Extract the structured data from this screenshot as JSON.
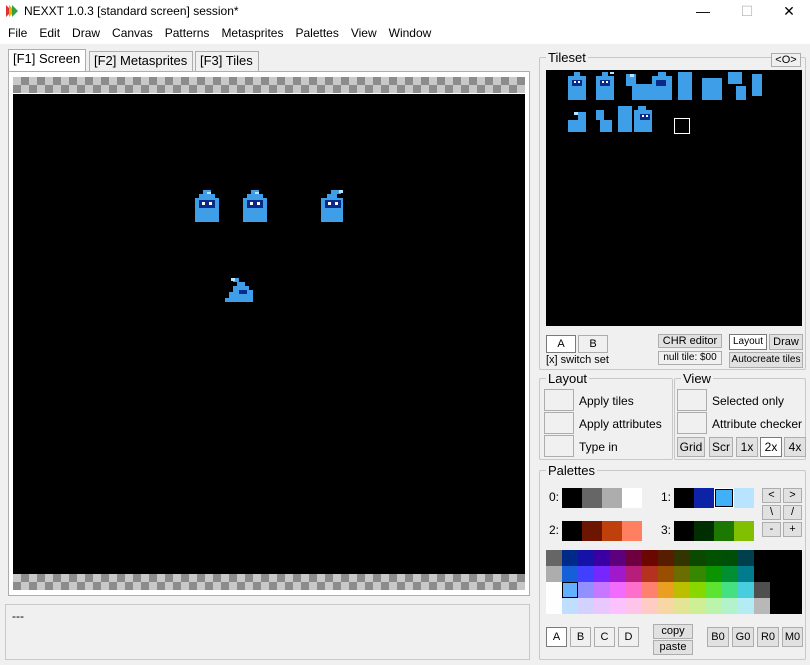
{
  "window": {
    "title": "NEXXT 1.0.3  [standard screen] session*",
    "minimize": "—",
    "maximize": "☐",
    "close": "✕"
  },
  "menu": [
    "File",
    "Edit",
    "Draw",
    "Canvas",
    "Patterns",
    "Metasprites",
    "Palettes",
    "View",
    "Window"
  ],
  "tabs": {
    "screen": "[F1] Screen",
    "metasprites": "[F2] Metasprites",
    "tiles": "[F3] Tiles"
  },
  "status": "---",
  "tileset": {
    "label": "Tileset",
    "toggle": "<O>",
    "set_a": "A",
    "set_b": "B",
    "switch_set": "[x] switch set",
    "chr_editor": "CHR editor",
    "null_tile": "null tile: $00",
    "layout": "Layout",
    "draw": "Draw",
    "autocreate": "Autocreate tiles"
  },
  "layout": {
    "label": "Layout",
    "apply_tiles": "Apply tiles",
    "apply_attributes": "Apply attributes",
    "type_in": "Type in"
  },
  "view": {
    "label": "View",
    "selected_only": "Selected only",
    "attribute_checker": "Attribute checker",
    "grid": "Grid",
    "scr": "Scr",
    "z1": "1x",
    "z2": "2x",
    "z4": "4x"
  },
  "palettes": {
    "label": "Palettes",
    "p0": "0:",
    "p1": "1:",
    "p2": "2:",
    "p3": "3:",
    "pal0": [
      "#000000",
      "#666666",
      "#adadad",
      "#ffffff"
    ],
    "pal1": [
      "#000000",
      "#0c23a8",
      "#40b0f8",
      "#b8e4ff"
    ],
    "pal2": [
      "#000000",
      "#6c1500",
      "#c0400c",
      "#ff8060"
    ],
    "pal3": [
      "#000000",
      "#002e00",
      "#1c7800",
      "#80c000"
    ],
    "nav": [
      "<",
      ">",
      "\\",
      "/",
      "-",
      "+"
    ],
    "sets": [
      "A",
      "B",
      "C",
      "D"
    ],
    "copy": "copy",
    "paste": "paste",
    "b0": "B0",
    "g0": "G0",
    "r0": "R0",
    "m0": "M0"
  }
}
